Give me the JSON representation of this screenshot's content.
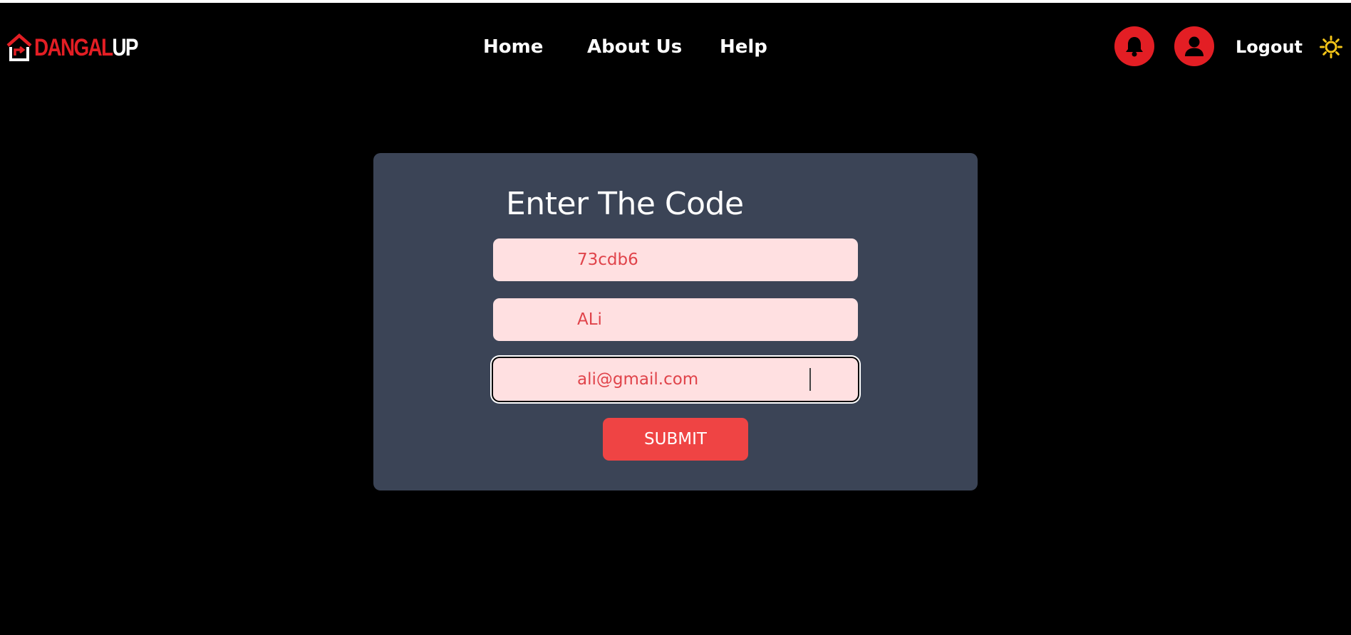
{
  "brand": {
    "name_part1": "DANGAL",
    "name_part2": "UP",
    "accent": "#e31e24"
  },
  "nav": {
    "home": "Home",
    "about": "About Us",
    "help": "Help"
  },
  "header_actions": {
    "notifications_icon": "bell-icon",
    "profile_icon": "user-icon",
    "logout": "Logout",
    "theme_icon": "sun-icon"
  },
  "form": {
    "title": "Enter The Code",
    "code_value": "73cdb6",
    "name_value": "ALi",
    "email_value": "ali@gmail.com",
    "submit_label": "SUBMIT"
  },
  "colors": {
    "background": "#000000",
    "card": "#3b4456",
    "input_bg": "#ffe0e1",
    "input_text": "#e0434a",
    "submit": "#ef4444",
    "sun": "#f5c518"
  }
}
